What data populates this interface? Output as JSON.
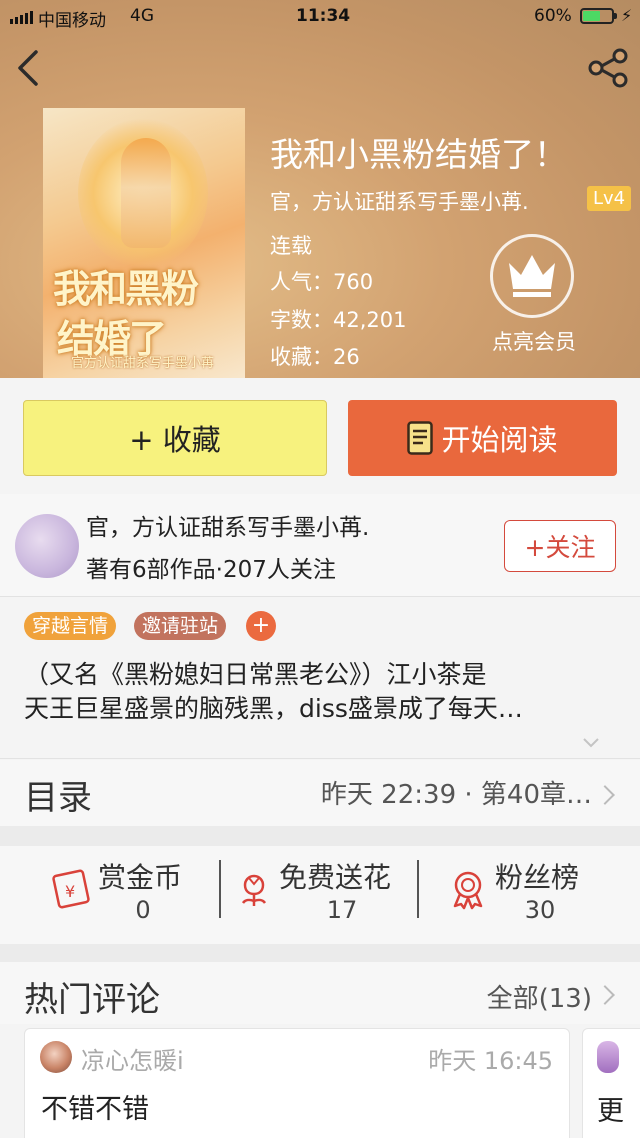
{
  "status_bar": {
    "carrier": "中国移动",
    "network": "4G",
    "time": "11:34",
    "battery_percent": "60%",
    "battery_level": 0.6
  },
  "header": {
    "back_icon": "chevron-left-icon",
    "share_icon": "share-icon"
  },
  "book": {
    "cover_title_line1": "我和黑粉",
    "cover_title_line2": "结婚了",
    "cover_author": "官方认证甜系写手墨小苒",
    "title": "我和小黑粉结婚了！",
    "author": "官，方认证甜系写手墨小苒.",
    "level": "Lv4",
    "status": "连载",
    "popularity_label": "人气：",
    "popularity": "760",
    "words_label": "字数：",
    "words": "42,201",
    "favorites_label": "收藏：",
    "favorites": "26",
    "member_label": "点亮会员",
    "member_icon": "crown-icon"
  },
  "actions": {
    "favorite_label": "+ 收藏",
    "read_label": "开始阅读",
    "read_icon": "book-icon"
  },
  "author_info": {
    "name": "官，方认证甜系写手墨小苒.",
    "stats": "著有6部作品·207人关注",
    "follow_label": "+关注"
  },
  "tags": [
    {
      "label": "穿越言情",
      "color": "#f0a23b"
    },
    {
      "label": "邀请驻站",
      "color": "#c2735e"
    }
  ],
  "tag_add_label": "+",
  "description": {
    "line1": "（又名《黑粉媳妇日常黑老公》）江小茶是",
    "line2": "天王巨星盛景的脑残黑，diss盛景成了每天…"
  },
  "toc": {
    "title": "目录",
    "latest": "昨天 22:39 · 第40章…"
  },
  "stats": [
    {
      "label": "赏金币",
      "value": "0",
      "icon": "red-envelope-icon"
    },
    {
      "label": "免费送花",
      "value": "17",
      "icon": "flower-icon"
    },
    {
      "label": "粉丝榜",
      "value": "30",
      "icon": "medal-icon"
    }
  ],
  "comments": {
    "title": "热门评论",
    "all_label": "全部(13)",
    "items": [
      {
        "user": "凉心怎暖i",
        "time": "昨天 16:45",
        "text": "不错不错"
      },
      {
        "user": "",
        "time": "",
        "text": "更"
      }
    ]
  },
  "colors": {
    "accent_orange": "#e9683d",
    "favorite_yellow": "#f7f27e",
    "level_badge": "#f5c147",
    "follow_red": "#d44a3d",
    "icon_red": "#d9423a"
  }
}
